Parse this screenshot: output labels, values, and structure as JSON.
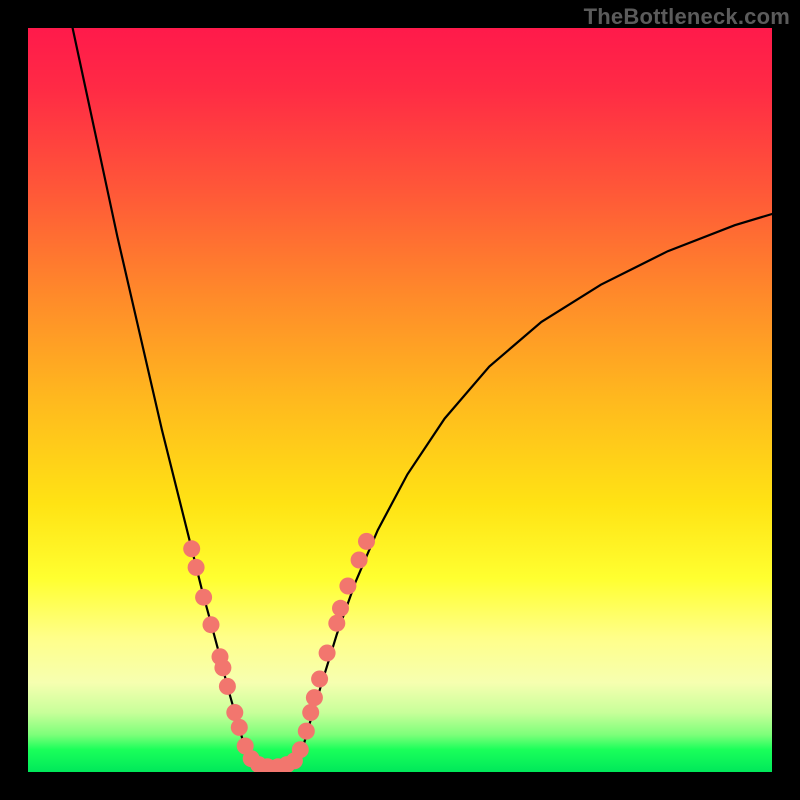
{
  "watermark": "TheBottleneck.com",
  "chart_data": {
    "type": "line",
    "title": "",
    "xlabel": "",
    "ylabel": "",
    "xlim": [
      0,
      100
    ],
    "ylim": [
      0,
      100
    ],
    "grid": false,
    "legend": false,
    "series": [
      {
        "name": "left-branch",
        "x": [
          6,
          9,
          12,
          15,
          18,
          20,
          22,
          23.5,
          24.6,
          25.8,
          26.8,
          27.8,
          28.8,
          30.0
        ],
        "y": [
          100,
          86,
          72,
          59,
          46,
          38,
          30,
          24,
          20,
          15.5,
          11.5,
          8,
          4.5,
          1.3
        ]
      },
      {
        "name": "floor",
        "x": [
          30.0,
          31.0,
          32.0,
          33.0,
          34.0,
          35.0,
          35.6,
          36.2
        ],
        "y": [
          1.3,
          0.8,
          0.6,
          0.5,
          0.6,
          0.8,
          1.1,
          1.4
        ]
      },
      {
        "name": "right-branch",
        "x": [
          36.2,
          37.0,
          38.0,
          39.5,
          41.5,
          44.0,
          47.0,
          51.0,
          56.0,
          62.0,
          69.0,
          77.0,
          86.0,
          95.0,
          100.0
        ],
        "y": [
          1.4,
          3.5,
          7.0,
          12.0,
          18.5,
          25.5,
          32.5,
          40.0,
          47.5,
          54.5,
          60.5,
          65.5,
          70.0,
          73.5,
          75.0
        ]
      }
    ],
    "markers": {
      "name": "highlight-dots",
      "color": "#f2766e",
      "radius": 8.5,
      "points": [
        {
          "x": 22.0,
          "y": 30.0
        },
        {
          "x": 22.6,
          "y": 27.5
        },
        {
          "x": 23.6,
          "y": 23.5
        },
        {
          "x": 24.6,
          "y": 19.8
        },
        {
          "x": 25.8,
          "y": 15.5
        },
        {
          "x": 26.2,
          "y": 14.0
        },
        {
          "x": 26.8,
          "y": 11.5
        },
        {
          "x": 27.8,
          "y": 8.0
        },
        {
          "x": 28.4,
          "y": 6.0
        },
        {
          "x": 29.2,
          "y": 3.5
        },
        {
          "x": 30.0,
          "y": 1.8
        },
        {
          "x": 31.0,
          "y": 1.0
        },
        {
          "x": 32.2,
          "y": 0.7
        },
        {
          "x": 33.6,
          "y": 0.7
        },
        {
          "x": 34.8,
          "y": 1.0
        },
        {
          "x": 35.8,
          "y": 1.5
        },
        {
          "x": 36.6,
          "y": 3.0
        },
        {
          "x": 37.4,
          "y": 5.5
        },
        {
          "x": 38.0,
          "y": 8.0
        },
        {
          "x": 38.5,
          "y": 10.0
        },
        {
          "x": 39.2,
          "y": 12.5
        },
        {
          "x": 40.2,
          "y": 16.0
        },
        {
          "x": 41.5,
          "y": 20.0
        },
        {
          "x": 42.0,
          "y": 22.0
        },
        {
          "x": 43.0,
          "y": 25.0
        },
        {
          "x": 44.5,
          "y": 28.5
        },
        {
          "x": 45.5,
          "y": 31.0
        }
      ]
    }
  }
}
